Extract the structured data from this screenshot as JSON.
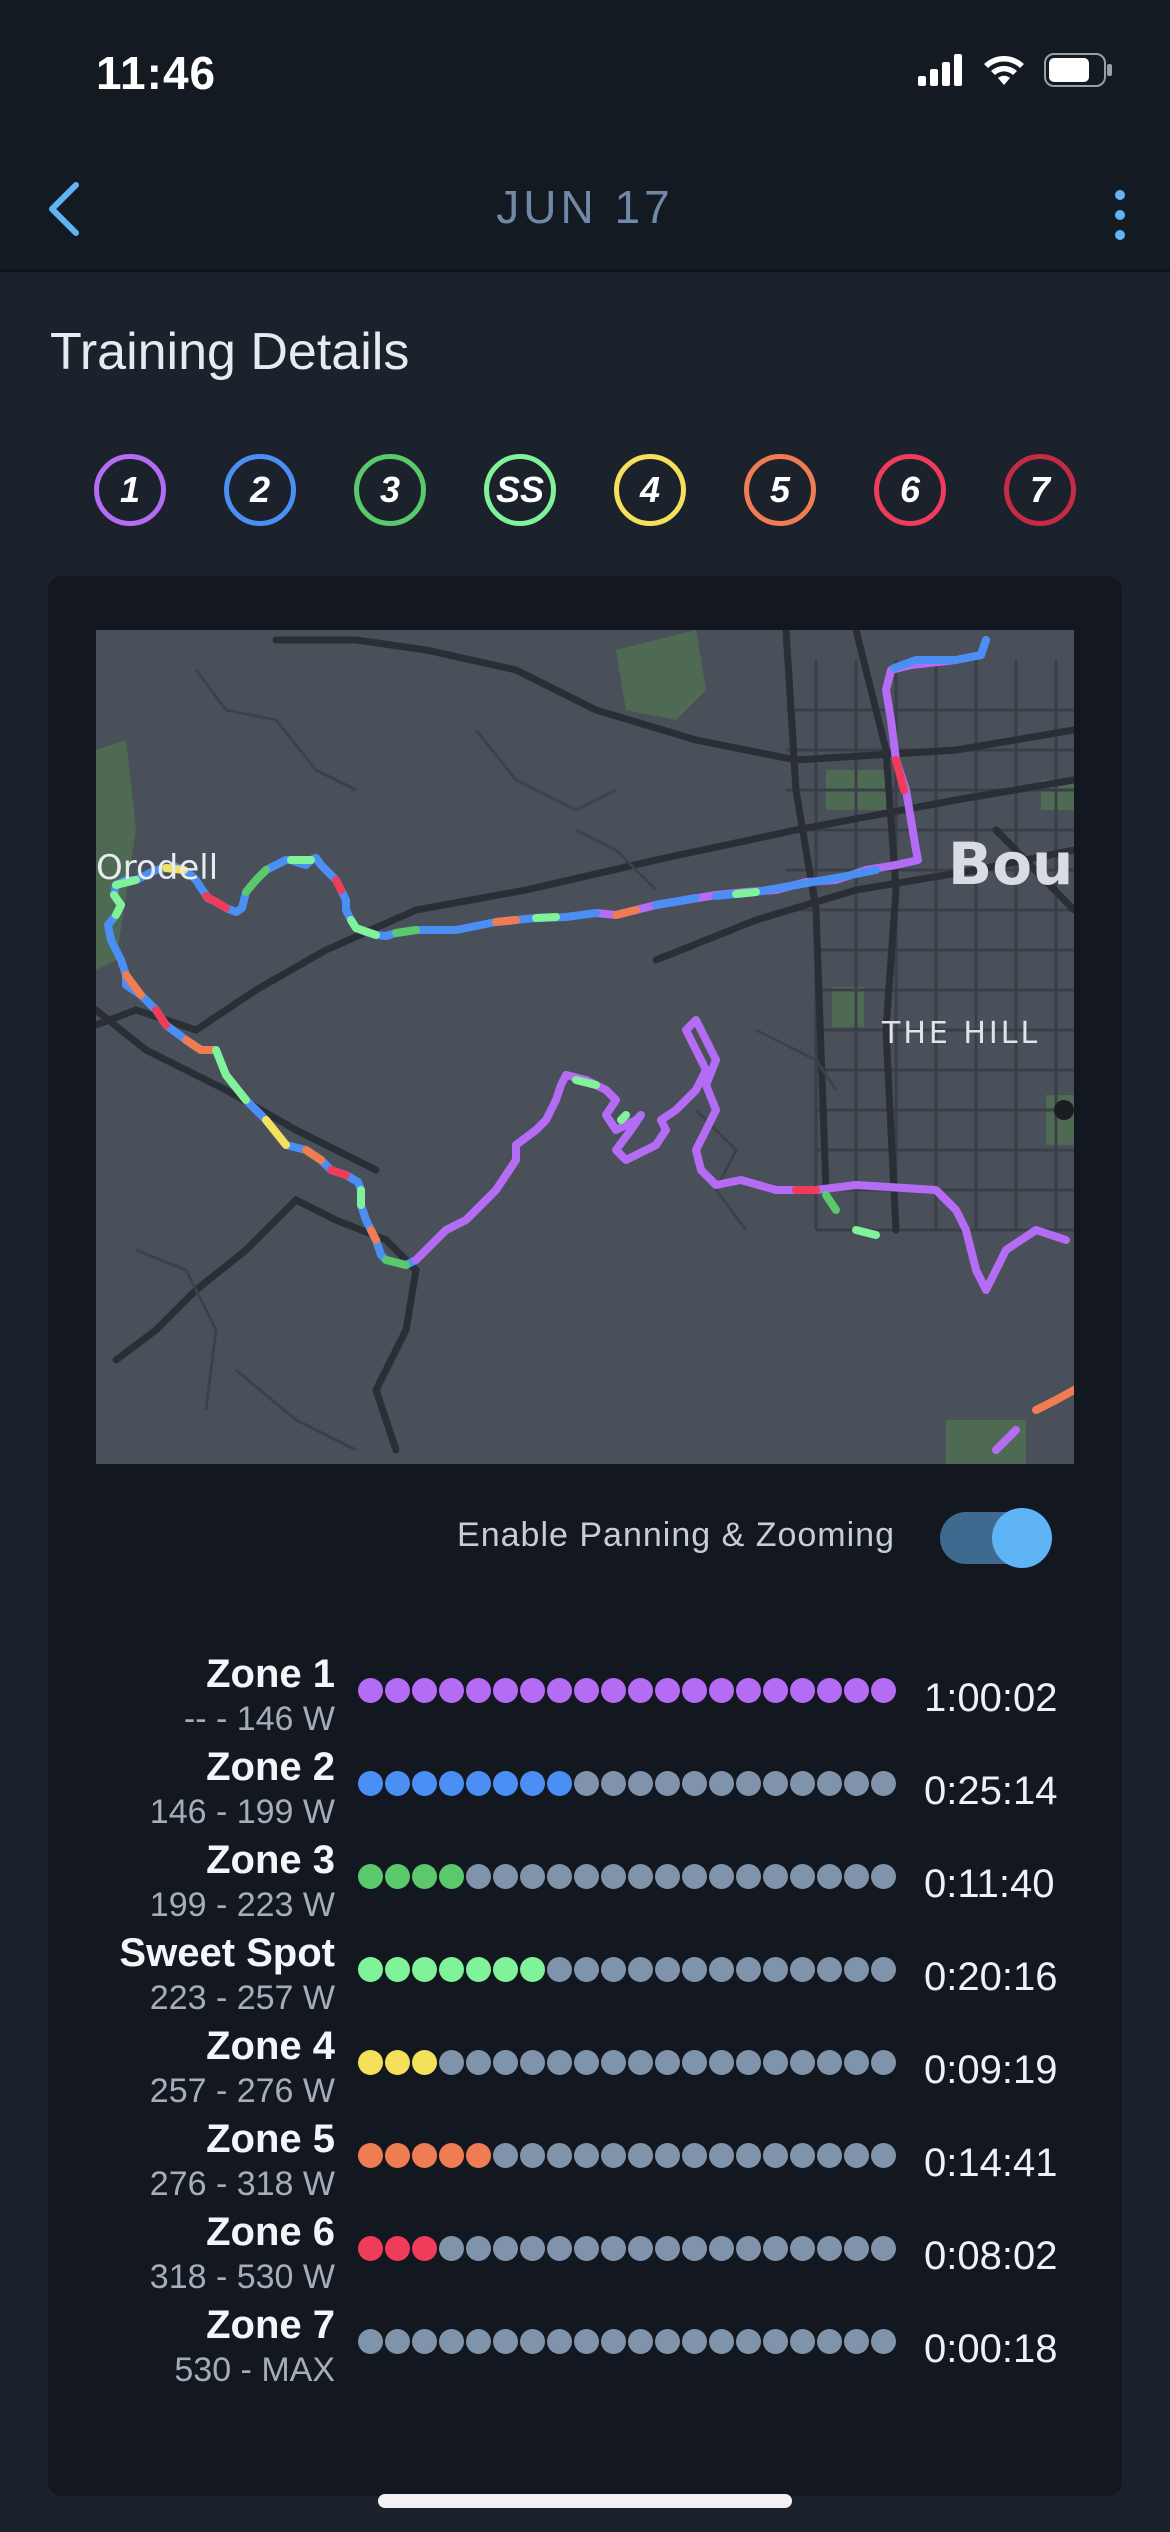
{
  "status_bar": {
    "time": "11:46"
  },
  "nav": {
    "title": "JUN 17"
  },
  "section": {
    "title": "Training Details"
  },
  "chips": [
    {
      "label": "1",
      "color": "#b56cf5"
    },
    {
      "label": "2",
      "color": "#4b8ff5"
    },
    {
      "label": "3",
      "color": "#5bc86b"
    },
    {
      "label": "SS",
      "color": "#7ff29a"
    },
    {
      "label": "4",
      "color": "#f4e05a"
    },
    {
      "label": "5",
      "color": "#ef7c52"
    },
    {
      "label": "6",
      "color": "#ee3c5a"
    },
    {
      "label": "7",
      "color": "#c42b44"
    }
  ],
  "map": {
    "labels": {
      "orodell": "Orodell",
      "boulder": "Boul",
      "the_hill": "THE HILL"
    }
  },
  "toggle": {
    "label": "Enable Panning & Zooming",
    "enabled": true
  },
  "zones": [
    {
      "name": "Zone 1",
      "range": "-- - 146 W",
      "time": "1:00:02",
      "filled_dots": 20,
      "total_dots": 20,
      "color": "#b56cf5"
    },
    {
      "name": "Zone 2",
      "range": "146 - 199 W",
      "time": "0:25:14",
      "filled_dots": 8,
      "total_dots": 20,
      "color": "#4b8ff5"
    },
    {
      "name": "Zone 3",
      "range": "199 - 223 W",
      "time": "0:11:40",
      "filled_dots": 4,
      "total_dots": 20,
      "color": "#5bc86b"
    },
    {
      "name": "Sweet Spot",
      "range": "223 - 257 W",
      "time": "0:20:16",
      "filled_dots": 7,
      "total_dots": 20,
      "color": "#7ff29a"
    },
    {
      "name": "Zone 4",
      "range": "257 - 276 W",
      "time": "0:09:19",
      "filled_dots": 3,
      "total_dots": 20,
      "color": "#f4e05a"
    },
    {
      "name": "Zone 5",
      "range": "276 - 318 W",
      "time": "0:14:41",
      "filled_dots": 5,
      "total_dots": 20,
      "color": "#ef7c52"
    },
    {
      "name": "Zone 6",
      "range": "318 - 530 W",
      "time": "0:08:02",
      "filled_dots": 3,
      "total_dots": 20,
      "color": "#ee3c5a"
    },
    {
      "name": "Zone 7",
      "range": "530 - MAX",
      "time": "0:00:18",
      "filled_dots": 0,
      "total_dots": 20,
      "color": "#c42b44"
    }
  ],
  "empty_dot_color": "#7f94aa",
  "accent": "#5fb4f5"
}
